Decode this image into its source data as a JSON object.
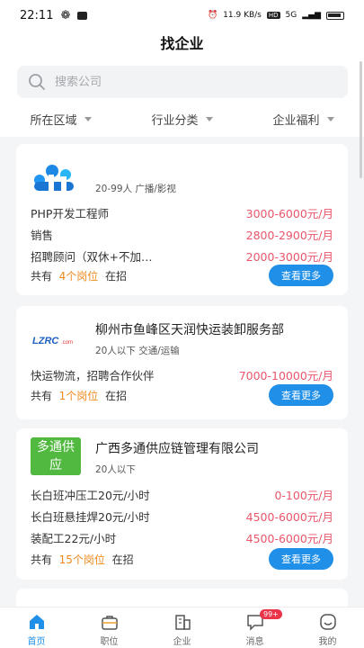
{
  "status_bar": {
    "time": "22:11",
    "speed": "11.9 KB/s",
    "hd": "HD",
    "signal": "5G"
  },
  "page_title": "找企业",
  "search": {
    "placeholder": "搜索公司"
  },
  "filters": [
    "所在区域",
    "行业分类",
    "企业福利"
  ],
  "companies": [
    {
      "name": "",
      "meta": "20-99人  广播/影视",
      "jobs": [
        {
          "title": "PHP开发工程师",
          "salary": "3000-6000元/月"
        },
        {
          "title": "销售",
          "salary": "2800-2900元/月"
        },
        {
          "title": "招聘顾问（双休+不加…",
          "salary": "2000-3000元/月"
        }
      ],
      "footer": {
        "prefix": "共有",
        "count": "4个岗位",
        "suffix": "在招"
      },
      "more": "查看更多"
    },
    {
      "name": "柳州市鱼峰区天润快运装卸服务部",
      "logo_text": "LZRC",
      "meta": "20人以下  交通/运输",
      "jobs": [
        {
          "title": "快运物流，招聘合作伙伴",
          "salary": "7000-10000元/月"
        }
      ],
      "footer": {
        "prefix": "共有",
        "count": "1个岗位",
        "suffix": "在招"
      },
      "more": "查看更多"
    },
    {
      "name": "广西多通供应链管理有限公司",
      "logo_text": "多通供应",
      "meta": "20人以下",
      "jobs": [
        {
          "title": "长白班冲压工20元/小时",
          "salary": "0-100元/月"
        },
        {
          "title": "长白班悬挂焊20元/小时",
          "salary": "4500-6000元/月"
        },
        {
          "title": "装配工22元/小时",
          "salary": "4500-6000元/月"
        }
      ],
      "footer": {
        "prefix": "共有",
        "count": "15个岗位",
        "suffix": "在招"
      },
      "more": "查看更多"
    }
  ],
  "tabbar": [
    {
      "label": "首页",
      "icon": "home-icon",
      "active": true
    },
    {
      "label": "职位",
      "icon": "briefcase-icon"
    },
    {
      "label": "企业",
      "icon": "building-icon"
    },
    {
      "label": "消息",
      "icon": "message-icon",
      "badge": "99+"
    },
    {
      "label": "我的",
      "icon": "profile-icon"
    }
  ],
  "colors": {
    "accent": "#1f8fe8",
    "salary": "#e9566b",
    "count": "#f08a1f"
  }
}
